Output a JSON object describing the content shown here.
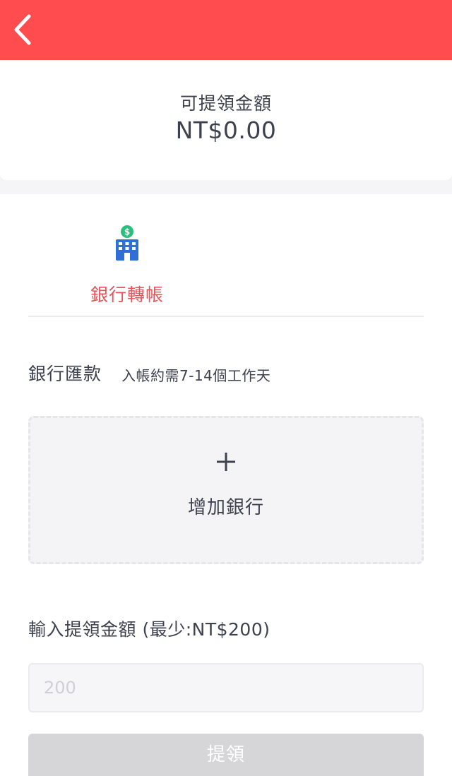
{
  "header": {
    "back_icon": "chevron-left-icon",
    "background_color": "#ff4d4f"
  },
  "balance": {
    "label": "可提領金額",
    "amount": "NT$0.00"
  },
  "withdraw_method": {
    "icon": "bank-building-icon",
    "label": "銀行轉帳",
    "label_color": "#e8545a"
  },
  "bank_section": {
    "title": "銀行匯款",
    "note": "入帳約需7-14個工作天",
    "add_bank_icon": "plus-icon",
    "add_bank_label": "增加銀行"
  },
  "amount": {
    "label": "輸入提領金額 (最少:NT$200)",
    "placeholder": "200",
    "value": ""
  },
  "submit": {
    "label": "提領"
  }
}
